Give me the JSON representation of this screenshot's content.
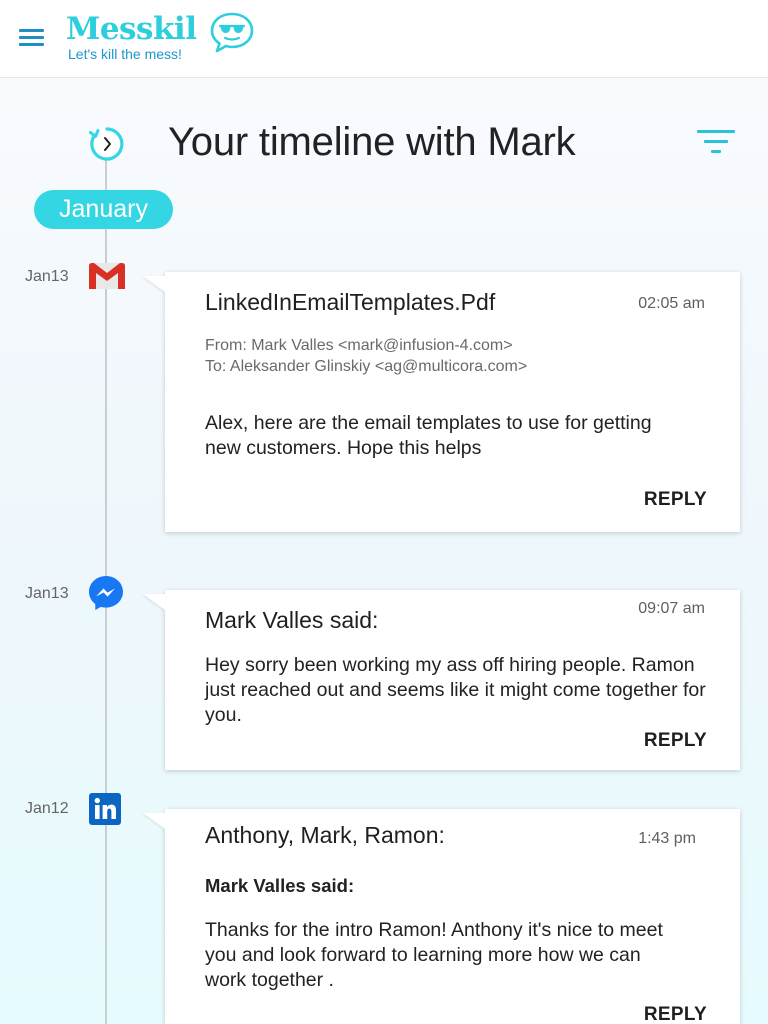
{
  "header": {
    "brand_name": "Messkil",
    "tagline": "Let's kill the mess!",
    "menu_icon": "hamburger-menu-icon",
    "logo_icon": "sunglasses-face-chat-icon"
  },
  "timeline": {
    "title": "Your timeline with Mark",
    "history_icon": "history-clock-icon",
    "filter_icon": "filter-icon",
    "month": "January"
  },
  "entries": [
    {
      "date": "Jan13",
      "source": "gmail",
      "source_icon": "gmail-icon",
      "title": "LinkedInEmailTemplates.Pdf",
      "time": "02:05 am",
      "from": "From: Mark Valles <mark@infusion-4.com>",
      "to": "To: Aleksander Glinskiy <ag@multicora.com>",
      "body": "Alex, here are the email templates to use for getting new customers. Hope this helps",
      "action": "REPLY"
    },
    {
      "date": "Jan13",
      "source": "messenger",
      "source_icon": "messenger-icon",
      "title": "Mark Valles said:",
      "time": "09:07 am",
      "body": "Hey sorry been working my ass off hiring people. Ramon just reached out and seems like it might come together for you.",
      "action": "REPLY"
    },
    {
      "date": "Jan12",
      "source": "linkedin",
      "source_icon": "linkedin-icon",
      "title": "Anthony, Mark, Ramon:",
      "time": "1:43 pm",
      "subtitle": "Mark Valles said:",
      "body": "Thanks for the intro Ramon! Anthony it's nice to meet you and look forward to learning more how we can work together .",
      "action": "REPLY"
    }
  ],
  "colors": {
    "brand": "#2ccfdb",
    "tagline": "#1f96c9",
    "accent": "#35d6e3",
    "gmail_red": "#d93025",
    "messenger_blue": "#1877f2",
    "linkedin_blue": "#0a66c2"
  }
}
